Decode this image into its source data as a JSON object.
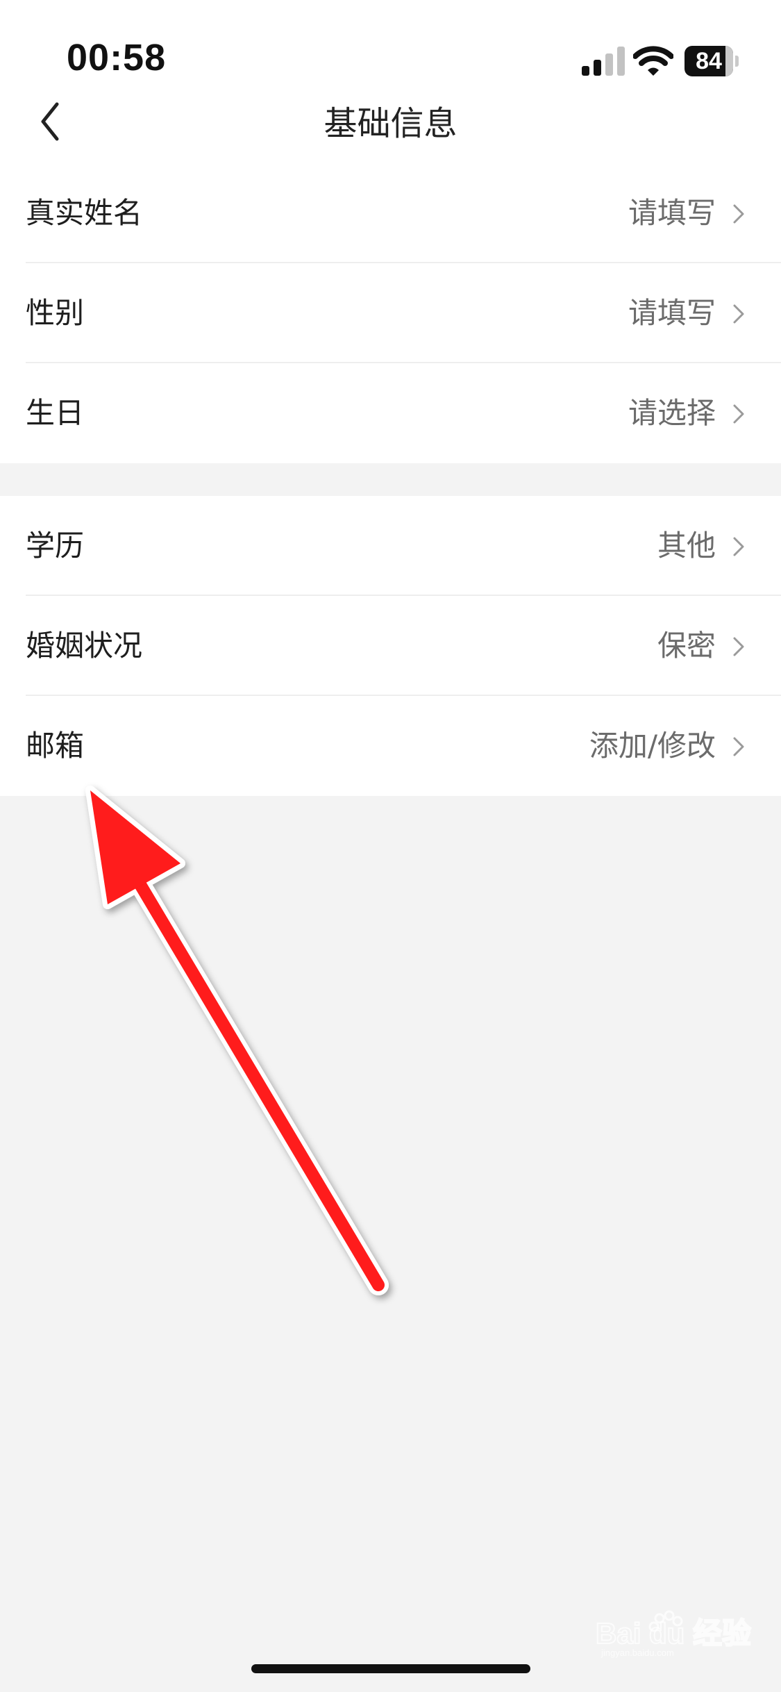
{
  "status_bar": {
    "time": "00:58",
    "battery": "84",
    "battery_level": 0.84
  },
  "nav": {
    "title": "基础信息",
    "back_icon": "chevron-left-icon"
  },
  "groups": [
    {
      "rows": [
        {
          "label": "真实姓名",
          "value": "请填写"
        },
        {
          "label": "性别",
          "value": "请填写"
        },
        {
          "label": "生日",
          "value": "请选择"
        }
      ]
    },
    {
      "rows": [
        {
          "label": "学历",
          "value": "其他"
        },
        {
          "label": "婚姻状况",
          "value": "保密"
        },
        {
          "label": "邮箱",
          "value": "添加/修改"
        }
      ]
    }
  ],
  "colors": {
    "page_background": "#f3f3f3",
    "row_background": "#ffffff",
    "label_text": "#1e1e1e",
    "value_text": "#6b6b6b",
    "annotation_arrow": "#ff1a1a"
  },
  "watermark": {
    "brand": "Baidu经验",
    "sub": "jingyan.baidu.com"
  }
}
